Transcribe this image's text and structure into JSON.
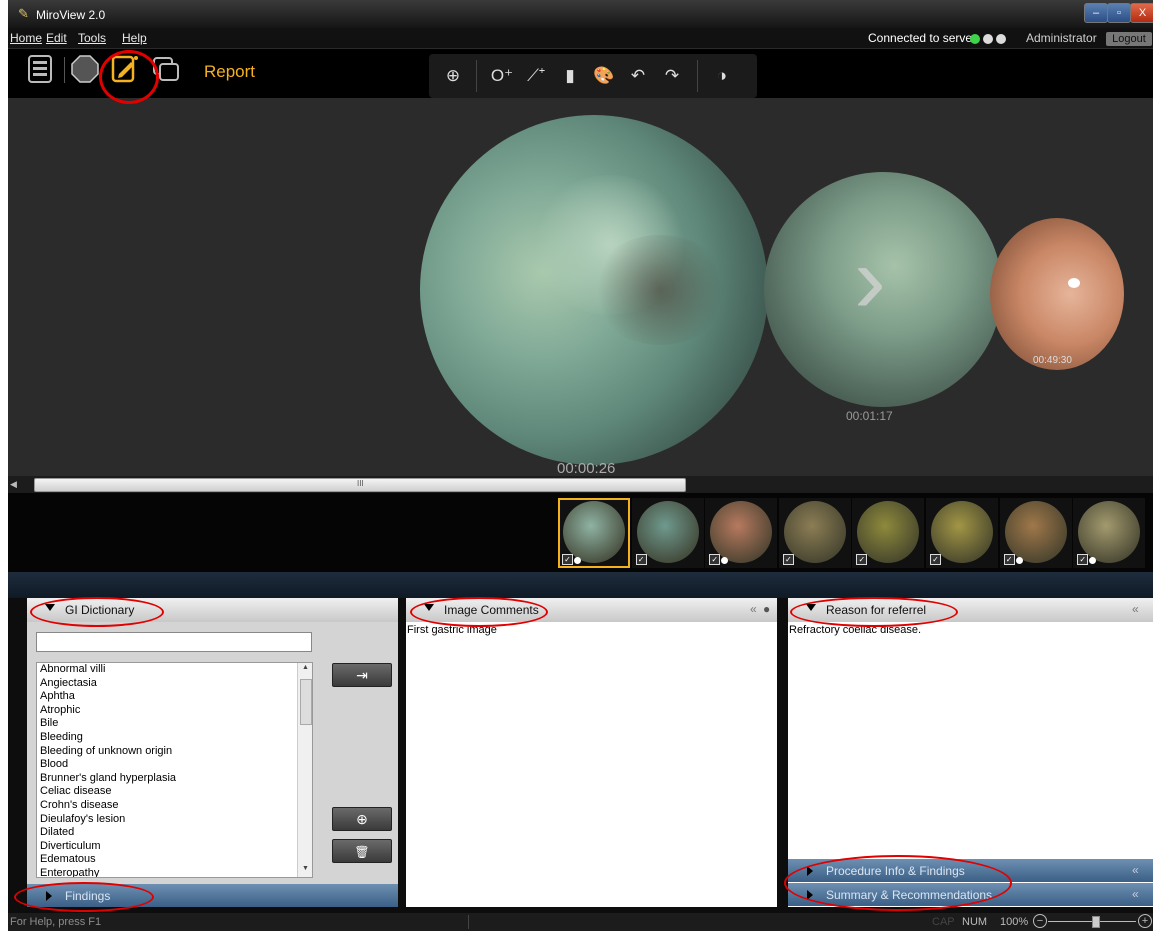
{
  "window": {
    "title": "MiroView 2.0",
    "btn_min": "–",
    "btn_max": "▫",
    "btn_close": "X"
  },
  "menu": {
    "items": [
      "Home",
      "Edit",
      "Tools",
      "Help"
    ]
  },
  "header": {
    "connection": "Connected to server",
    "user": "Administrator",
    "logout": "Logout"
  },
  "toolbar": {
    "report_label": "Report"
  },
  "viewer": {
    "main_time": "00:00:26",
    "second_time": "00:01:17",
    "third_time": "00:49:30",
    "scroll_grip": "III",
    "nav_arrow": "›"
  },
  "thumbnails": [
    {
      "color": "#8fb3a3",
      "checked": true,
      "comment": true,
      "selected": true
    },
    {
      "color": "#6f9a8e",
      "checked": true,
      "comment": false,
      "selected": false
    },
    {
      "color": "#b77a5f",
      "checked": true,
      "comment": true,
      "selected": false
    },
    {
      "color": "#8c7e55",
      "checked": true,
      "comment": false,
      "selected": false
    },
    {
      "color": "#8e8a3c",
      "checked": true,
      "comment": false,
      "selected": false
    },
    {
      "color": "#a29645",
      "checked": true,
      "comment": false,
      "selected": false
    },
    {
      "color": "#a0784a",
      "checked": true,
      "comment": true,
      "selected": false
    },
    {
      "color": "#a39a6e",
      "checked": true,
      "comment": true,
      "selected": false
    }
  ],
  "gi_dictionary": {
    "title": "GI Dictionary",
    "search_value": "",
    "items": [
      "Abnormal villi",
      "Angiectasia",
      "Aphtha",
      "Atrophic",
      "Bile",
      "Bleeding",
      "Bleeding of unknown origin",
      "Blood",
      "Brunner's gland hyperplasia",
      "Celiac disease",
      "Crohn's disease",
      "Dieulafoy's lesion",
      "Dilated",
      "Diverticulum",
      "Edematous",
      "Enteropathy"
    ],
    "insert_icon": "⇥",
    "add_icon": "⊕",
    "delete_icon": "🗑"
  },
  "findings": {
    "title": "Findings"
  },
  "image_comments": {
    "title": "Image Comments",
    "text": "First gastric image"
  },
  "reason_referral": {
    "title": "Reason for referrel",
    "text": "Refractory coeliac disease."
  },
  "procedure_info": {
    "title": "Procedure Info & Findings"
  },
  "summary": {
    "title": "Summary & Recommendations"
  },
  "dock_icon": "«",
  "status": {
    "help": "For Help, press F1",
    "caps": "CAP",
    "num": "NUM",
    "zoom": "100%"
  },
  "colors": {
    "accent": "#f5b21f",
    "panel_bar": "#4a6f95",
    "highlight_ring": "#e00000"
  }
}
